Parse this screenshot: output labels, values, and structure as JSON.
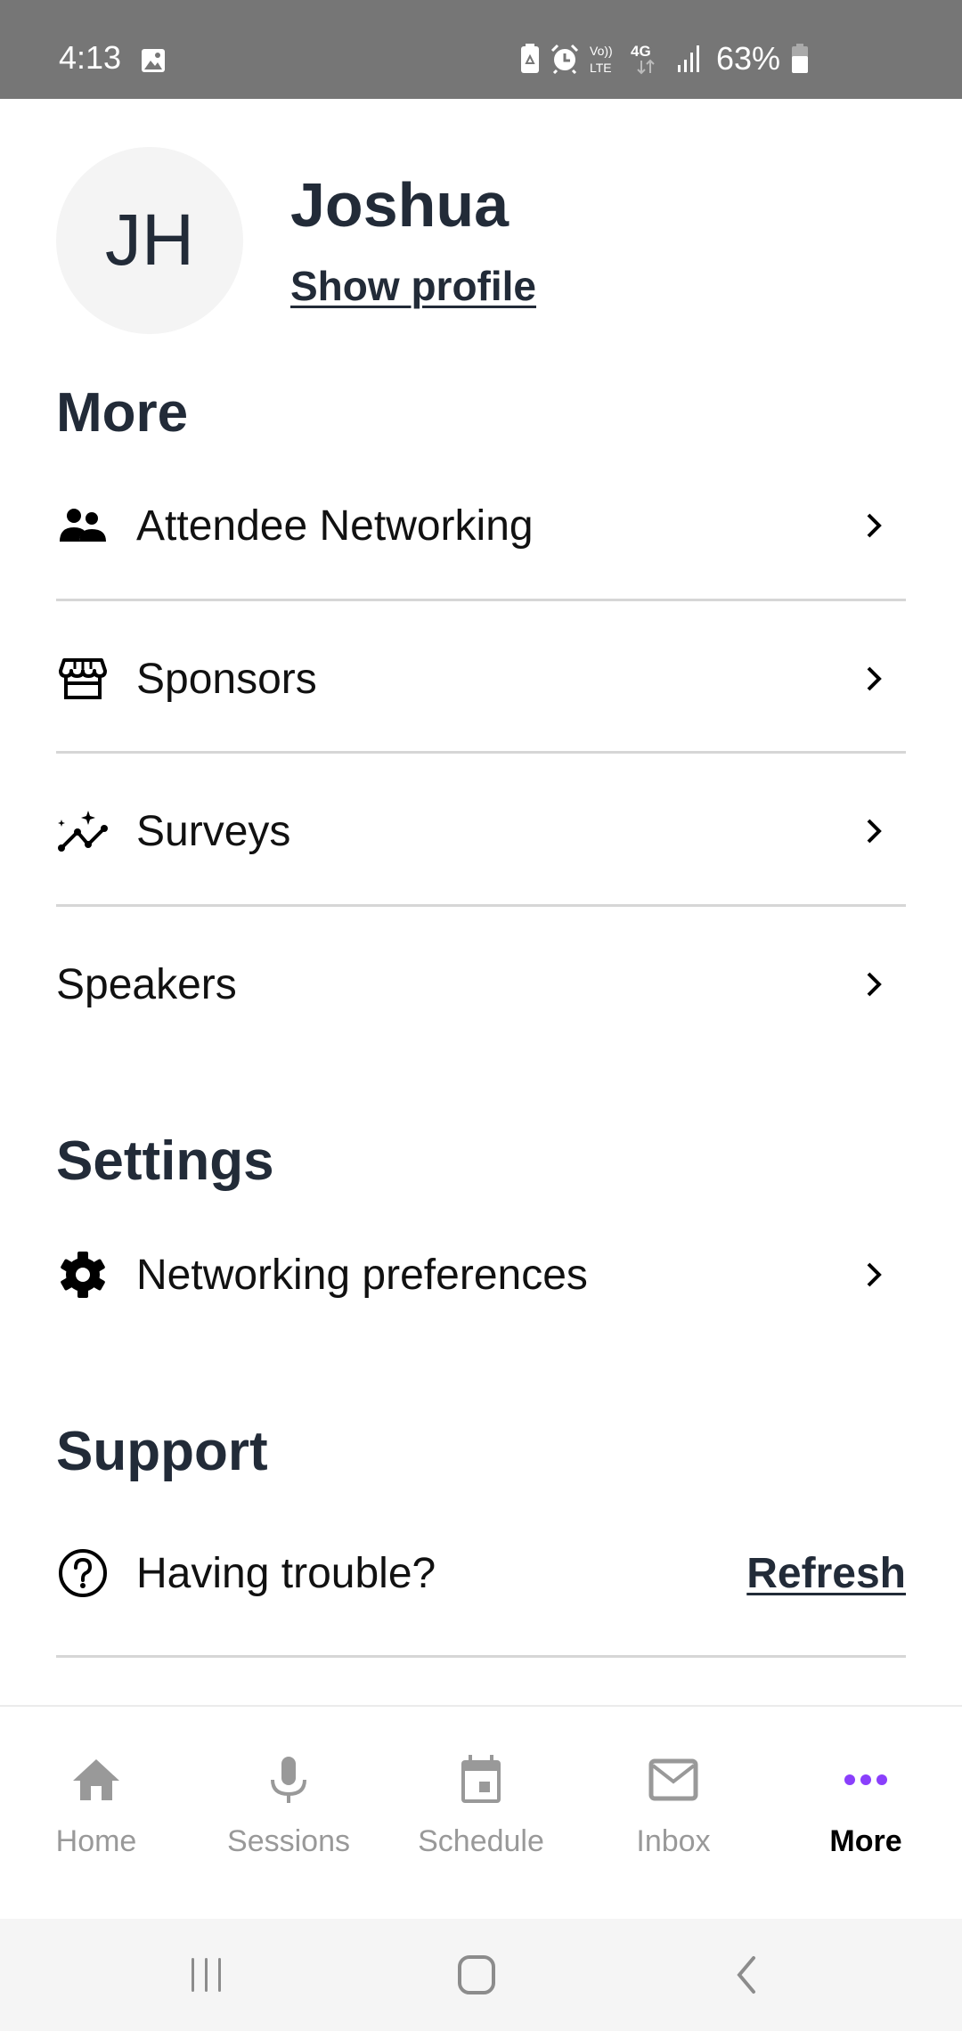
{
  "status_bar": {
    "time": "4:13",
    "battery_percent": "63%",
    "icons": [
      "image-icon",
      "battery-saver-icon",
      "alarm-icon",
      "volte-icon",
      "4g-data-icon",
      "signal-icon",
      "battery-icon"
    ],
    "volte_top": "Vo))",
    "volte_bottom": "LTE",
    "network": "4G"
  },
  "profile": {
    "initials": "JH",
    "name": "Joshua",
    "show_profile_label": "Show profile"
  },
  "sections": {
    "more": {
      "title": "More",
      "items": [
        {
          "label": "Attendee Networking",
          "icon": "people-icon"
        },
        {
          "label": "Sponsors",
          "icon": "storefront-icon"
        },
        {
          "label": "Surveys",
          "icon": "sparkle-chart-icon"
        },
        {
          "label": "Speakers",
          "icon": ""
        }
      ]
    },
    "settings": {
      "title": "Settings",
      "items": [
        {
          "label": "Networking preferences",
          "icon": "gear-icon"
        }
      ]
    },
    "support": {
      "title": "Support",
      "trouble_label": "Having trouble?",
      "refresh_label": "Refresh",
      "icon": "help-circle-icon"
    }
  },
  "bottom_nav": {
    "active": "More",
    "accent_color": "#8a3ffc",
    "items": [
      {
        "label": "Home",
        "icon": "home-icon"
      },
      {
        "label": "Sessions",
        "icon": "microphone-icon"
      },
      {
        "label": "Schedule",
        "icon": "calendar-icon"
      },
      {
        "label": "Inbox",
        "icon": "mail-icon"
      },
      {
        "label": "More",
        "icon": "more-dots-icon"
      }
    ]
  },
  "system_nav": {
    "buttons": [
      "recents-button",
      "home-button",
      "back-button"
    ]
  }
}
